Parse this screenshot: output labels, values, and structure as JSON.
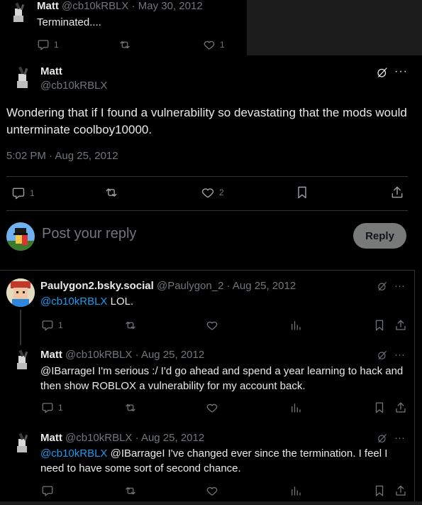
{
  "top_tweet": {
    "name": "Matt",
    "handle_date": "@cb10kRBLX · May 30, 2012",
    "text": "Terminated....",
    "replies": "1",
    "likes": "1"
  },
  "main_tweet": {
    "name": "Matt",
    "handle": "@cb10kRBLX",
    "text": "Wondering that if I found a vulnerability so devastating that the mods would unterminate coolboy10000.",
    "timestamp": "5:02 PM · Aug 25, 2012",
    "replies": "1",
    "likes": "2"
  },
  "reply_box": {
    "placeholder": "Post your reply",
    "button_label": "Reply"
  },
  "replies": [
    {
      "name": "Paulygon2.bsky.social",
      "handle_date": "@Paulygon_2 · Aug 25, 2012",
      "mention": "@cb10kRBLX",
      "text": " LOL.",
      "replies": "1"
    },
    {
      "name": "Matt",
      "handle_date": "@cb10kRBLX · Aug 25, 2012",
      "mention": "",
      "text": "@IBarrageI I'm serious :/ I'd go ahead and spend a year learning to hack and then show ROBLOX a vulnerability for my account back.",
      "replies": "1"
    },
    {
      "name": "Matt",
      "handle_date": "@cb10kRBLX · Aug 25, 2012",
      "mention": "@cb10kRBLX",
      "text": " @IBarrageI I've changed ever since the termination. I feel I need to have some sort of second chance.",
      "replies": ""
    }
  ],
  "colors": {
    "background": "#000000",
    "text": "#e7e9ea",
    "secondary": "#71767b",
    "link": "#1d9bf0",
    "border": "#2f3336"
  }
}
